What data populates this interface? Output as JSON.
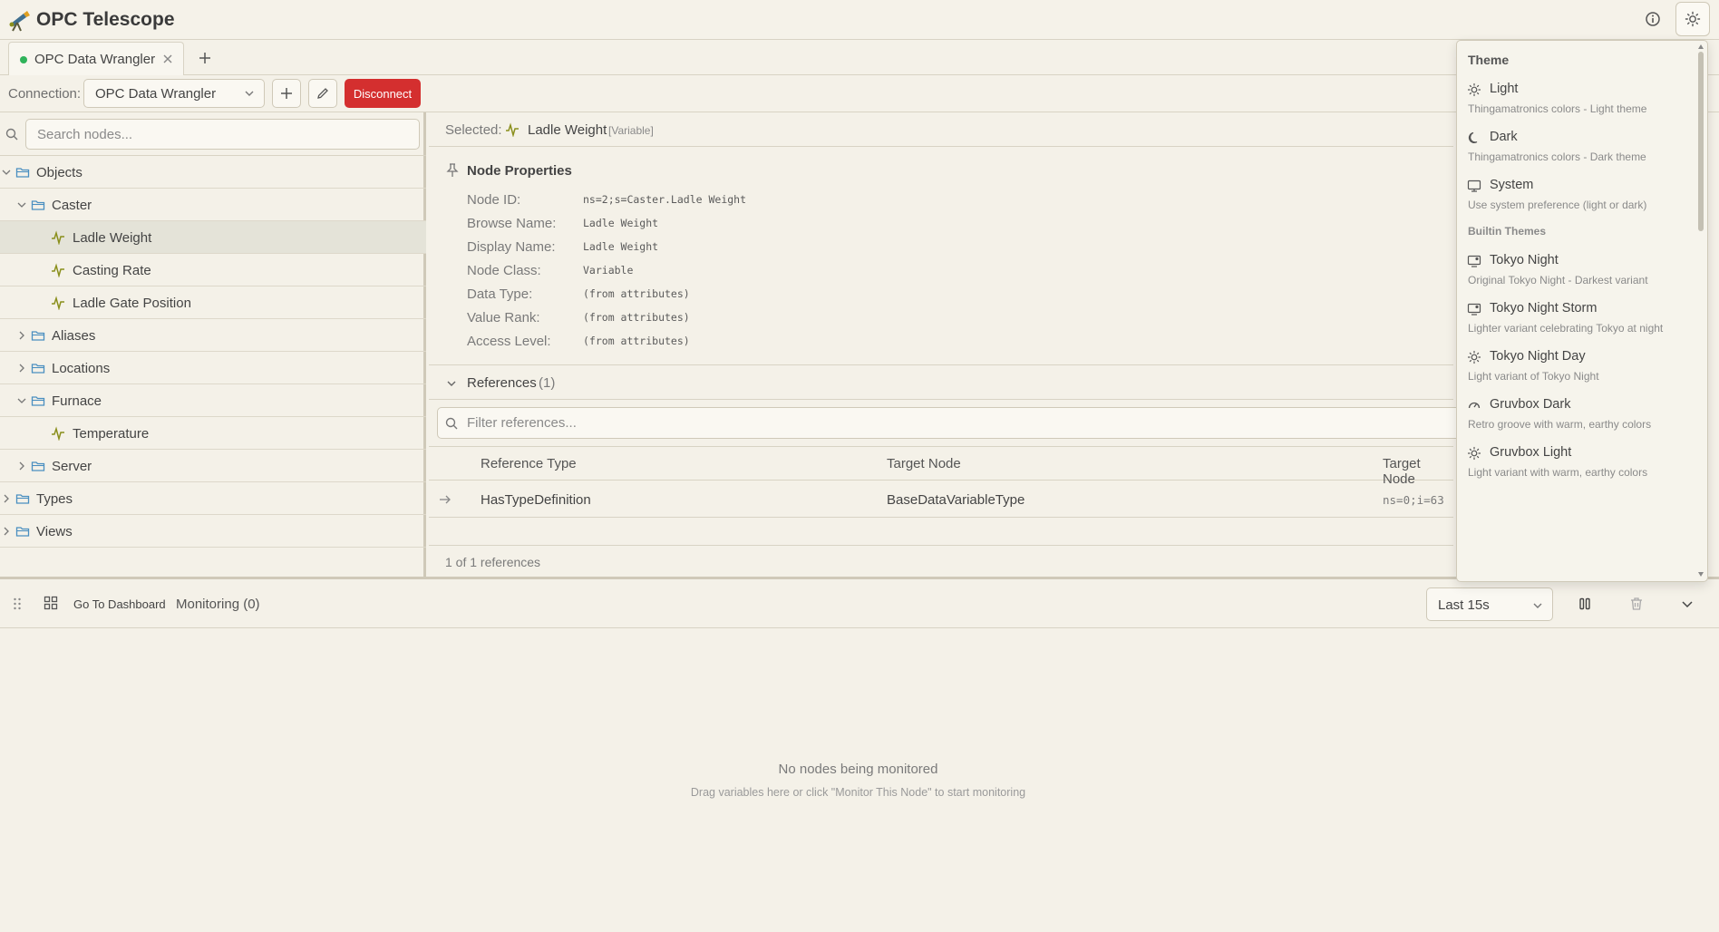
{
  "app": {
    "title": "OPC Telescope"
  },
  "tabs": [
    {
      "label": "OPC Data Wrangler"
    }
  ],
  "connection": {
    "label": "Connection:",
    "selected": "OPC Data Wrangler",
    "disconnect_label": "Disconnect"
  },
  "tree": {
    "search_placeholder": "Search nodes...",
    "items": [
      {
        "label": "Objects",
        "depth": 0,
        "type": "folder",
        "expanded": true
      },
      {
        "label": "Caster",
        "depth": 1,
        "type": "folder",
        "expanded": true
      },
      {
        "label": "Ladle Weight",
        "depth": 2,
        "type": "variable",
        "selected": true
      },
      {
        "label": "Casting Rate",
        "depth": 2,
        "type": "variable"
      },
      {
        "label": "Ladle Gate Position",
        "depth": 2,
        "type": "variable"
      },
      {
        "label": "Aliases",
        "depth": 1,
        "type": "folder",
        "expanded": false
      },
      {
        "label": "Locations",
        "depth": 1,
        "type": "folder",
        "expanded": false
      },
      {
        "label": "Furnace",
        "depth": 1,
        "type": "folder",
        "expanded": true
      },
      {
        "label": "Temperature",
        "depth": 2,
        "type": "variable"
      },
      {
        "label": "Server",
        "depth": 1,
        "type": "folder",
        "expanded": false
      },
      {
        "label": "Types",
        "depth": 0,
        "type": "folder",
        "expanded": false
      },
      {
        "label": "Views",
        "depth": 0,
        "type": "folder",
        "expanded": false
      }
    ]
  },
  "selected": {
    "label": "Selected:",
    "name": "Ladle Weight",
    "node_class": "[Variable]"
  },
  "node_properties": {
    "title": "Node Properties",
    "rows": [
      {
        "key": "Node ID:",
        "value": "ns=2;s=Caster.Ladle Weight"
      },
      {
        "key": "Browse Name:",
        "value": "Ladle Weight"
      },
      {
        "key": "Display Name:",
        "value": "Ladle Weight"
      },
      {
        "key": "Node Class:",
        "value": "Variable"
      },
      {
        "key": "Data Type:",
        "value": "(from attributes)"
      },
      {
        "key": "Value Rank:",
        "value": "(from attributes)"
      },
      {
        "key": "Access Level:",
        "value": "(from attributes)"
      }
    ]
  },
  "references": {
    "title": "References",
    "count": "(1)",
    "filter_placeholder": "Filter references...",
    "columns": [
      "Reference Type",
      "Target Node",
      "Target Node"
    ],
    "rows": [
      {
        "type": "HasTypeDefinition",
        "target": "BaseDataVariableType",
        "target_id": "ns=0;i=63"
      }
    ],
    "footer": "1 of 1 references"
  },
  "monitoring": {
    "dashboard_label": "Go To Dashboard",
    "label": "Monitoring (0)",
    "time_range": "Last 15s",
    "empty_title": "No nodes being monitored",
    "empty_subtitle": "Drag variables here or click \"Monitor This Node\" to start monitoring"
  },
  "theme_menu": {
    "title": "Theme",
    "builtin_section": "Builtin Themes",
    "items": [
      {
        "name": "Light",
        "desc": "Thingamatronics colors - Light theme",
        "icon": "sun-icon"
      },
      {
        "name": "Dark",
        "desc": "Thingamatronics colors - Dark theme",
        "icon": "moon-icon"
      },
      {
        "name": "System",
        "desc": "Use system preference (light or dark)",
        "icon": "monitor-icon"
      },
      {
        "name": "Tokyo Night",
        "desc": "Original Tokyo Night - Darkest variant",
        "icon": "monitor-moon-icon"
      },
      {
        "name": "Tokyo Night Storm",
        "desc": "Lighter variant celebrating Tokyo at night",
        "icon": "monitor-moon-icon"
      },
      {
        "name": "Tokyo Night Day",
        "desc": "Light variant of Tokyo Night",
        "icon": "sun-icon"
      },
      {
        "name": "Gruvbox Dark",
        "desc": "Retro groove with warm, earthy colors",
        "icon": "gauge-icon"
      },
      {
        "name": "Gruvbox Light",
        "desc": "Light variant with warm, earthy colors",
        "icon": "sun-icon"
      }
    ]
  },
  "colors": {
    "accent_variable": "#8a8f1c",
    "folder": "#4a8fc0",
    "disconnect": "#d42f2f",
    "status_connected": "#2fb35a"
  }
}
